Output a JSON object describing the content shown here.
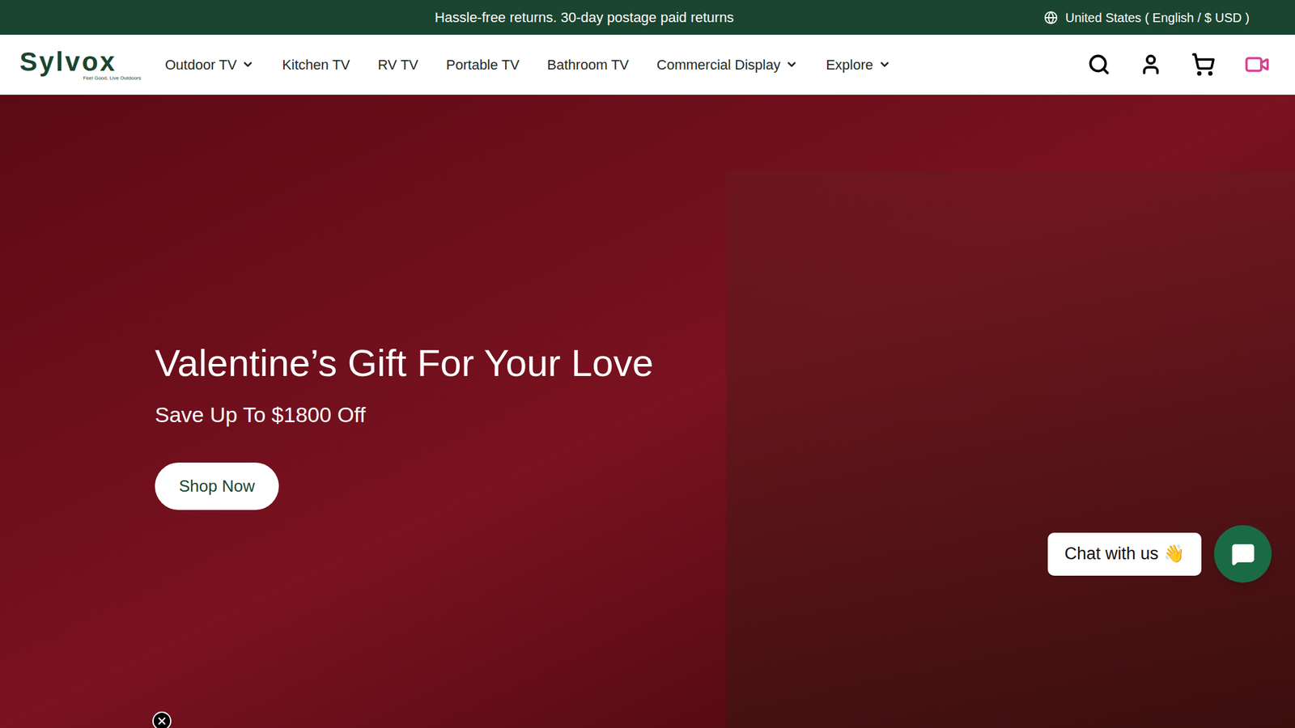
{
  "announcement": {
    "text": "Hassle-free returns. 30-day postage paid returns",
    "locale": "United States ( English / $ USD )"
  },
  "logo": {
    "name": "Sylvox",
    "tagline": "Feel Good, Live Outdoors"
  },
  "nav": {
    "items": [
      {
        "label": "Outdoor TV",
        "dropdown": true
      },
      {
        "label": "Kitchen TV",
        "dropdown": false
      },
      {
        "label": "RV TV",
        "dropdown": false
      },
      {
        "label": "Portable TV",
        "dropdown": false
      },
      {
        "label": "Bathroom TV",
        "dropdown": false
      },
      {
        "label": "Commercial Display",
        "dropdown": true
      },
      {
        "label": "Explore",
        "dropdown": true
      }
    ]
  },
  "hero": {
    "title": "Valentine’s Gift For Your Love",
    "subtitle": "Save Up To $1800 Off",
    "button": "Shop Now"
  },
  "chat": {
    "label": "Chat with us",
    "emoji": "👋"
  }
}
